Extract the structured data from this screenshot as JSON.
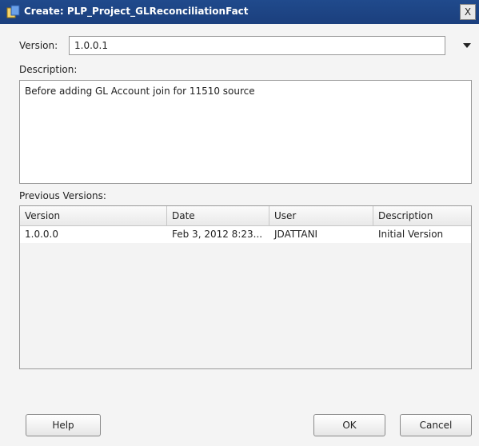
{
  "window": {
    "title": "Create: PLP_Project_GLReconciliationFact",
    "close_glyph": "X"
  },
  "form": {
    "version_label": "Version:",
    "version_value": "1.0.0.1",
    "description_label": "Description:",
    "description_value": "Before adding GL Account join for 11510 source",
    "previous_versions_label": "Previous Versions:"
  },
  "table": {
    "columns": [
      "Version",
      "Date",
      "User",
      "Description"
    ],
    "rows": [
      [
        "1.0.0.0",
        "Feb 3, 2012 8:23...",
        "JDATTANI",
        "Initial Version"
      ]
    ]
  },
  "buttons": {
    "help": "Help",
    "ok": "OK",
    "cancel": "Cancel"
  },
  "colors": {
    "titlebar": "#1f4787",
    "window_bg": "#f4f4f4"
  },
  "icons": {
    "title": "app-window-icon",
    "dropdown": "dropdown-arrow-icon"
  }
}
